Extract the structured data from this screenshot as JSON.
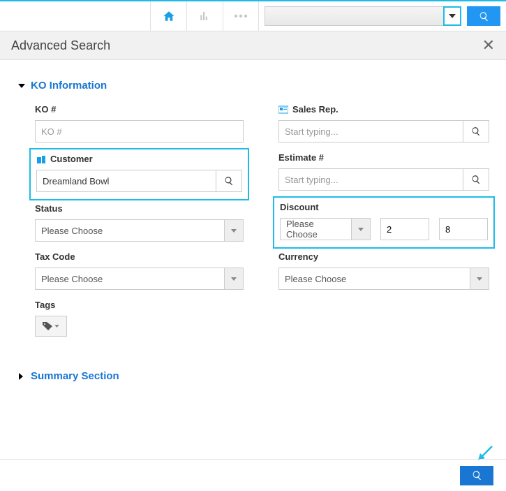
{
  "header": {
    "title": "Advanced Search"
  },
  "sections": {
    "ko_info": {
      "title": "KO Information",
      "expanded": true
    },
    "summary": {
      "title": "Summary Section",
      "expanded": false
    }
  },
  "fields": {
    "ko_number": {
      "label": "KO #",
      "placeholder": "KO #",
      "value": ""
    },
    "customer": {
      "label": "Customer",
      "value": "Dreamland Bowl"
    },
    "status": {
      "label": "Status",
      "placeholder": "Please Choose"
    },
    "tax_code": {
      "label": "Tax Code",
      "placeholder": "Please Choose"
    },
    "tags": {
      "label": "Tags"
    },
    "sales_rep": {
      "label": "Sales Rep.",
      "placeholder": "Start typing..."
    },
    "estimate": {
      "label": "Estimate #",
      "placeholder": "Start typing..."
    },
    "discount": {
      "label": "Discount",
      "placeholder": "Please Choose",
      "from": "2",
      "to": "8"
    },
    "currency": {
      "label": "Currency",
      "placeholder": "Please Choose"
    }
  }
}
